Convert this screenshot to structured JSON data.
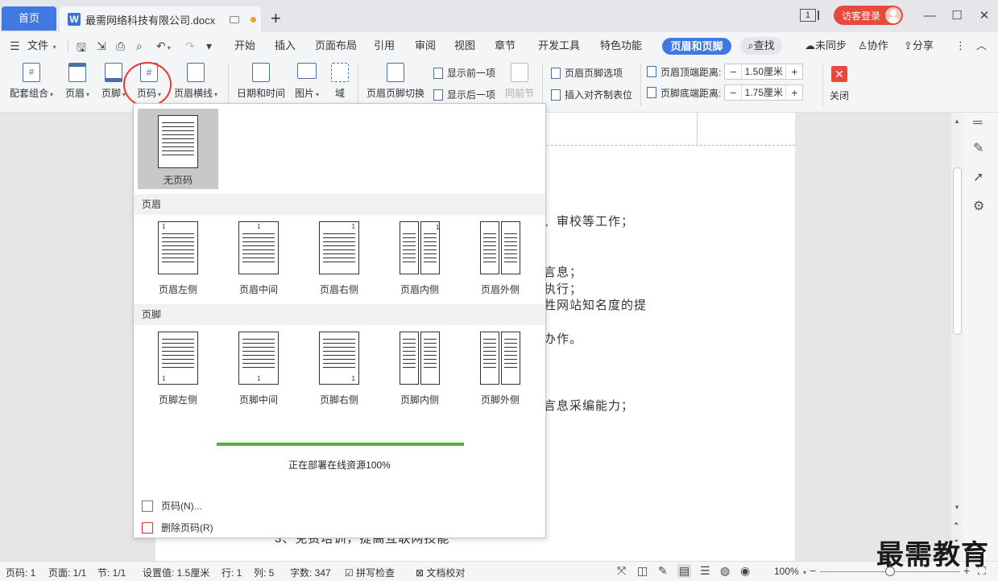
{
  "titlebar": {
    "home_tab": "首页",
    "doc_tab": "最需网络科技有限公司.docx",
    "window_count": "1",
    "login": "访客登录"
  },
  "menu": {
    "file": "文件",
    "items": [
      "开始",
      "插入",
      "页面布局",
      "引用",
      "审阅",
      "视图",
      "章节",
      "开发工具",
      "特色功能"
    ],
    "active": "页眉和页脚",
    "search": "查找",
    "sync": "未同步",
    "collab": "协作",
    "share": "分享"
  },
  "ribbon": {
    "combo": "配套组合",
    "header": "页眉",
    "footer": "页脚",
    "page_number": "页码",
    "header_line": "页眉横线",
    "datetime": "日期和时间",
    "picture": "图片",
    "field": "域",
    "switch": "页眉页脚切换",
    "show_prev": "显示前一项",
    "show_next": "显示后一项",
    "same_prev": "同前节",
    "options": "页眉页脚选项",
    "align_tab": "插入对齐制表位",
    "top_dist_label": "页眉顶端距离:",
    "top_dist_value": "1.50厘米",
    "bottom_dist_label": "页脚底端距离:",
    "bottom_dist_value": "1.75厘米",
    "close": "关闭"
  },
  "dropdown": {
    "no_page_number": "无页码",
    "header_section": "页眉",
    "footer_section": "页脚",
    "header_items": [
      "页眉左侧",
      "页眉中间",
      "页眉右侧",
      "页眉内侧",
      "页眉外侧"
    ],
    "footer_items": [
      "页脚左侧",
      "页脚中间",
      "页脚右侧",
      "页脚内侧",
      "页脚外侧"
    ],
    "progress_text": "正在部署在线资源100%",
    "progress": 1.0,
    "menu_page_number": "页码(N)...",
    "menu_delete": "删除页码(R)"
  },
  "document": {
    "lines": [
      "、审校等工作；",
      "言息；",
      "执行；",
      "牲网站知名度的提",
      "办作。",
      "言息采编能力；",
      "3、免费培训，提高互联网技能"
    ]
  },
  "status": {
    "page": "页码: 1",
    "pages": "页面: 1/1",
    "section": "节: 1/1",
    "setting": "设置值: 1.5厘米",
    "row": "行: 1",
    "col": "列: 5",
    "words": "字数: 347",
    "spell": "拼写检查",
    "proof": "文档校对",
    "zoom": "100%"
  },
  "watermark": "最需教育",
  "colors": {
    "accent": "#3f79e1",
    "danger": "#e64a3c",
    "progress": "#55ae3f"
  }
}
